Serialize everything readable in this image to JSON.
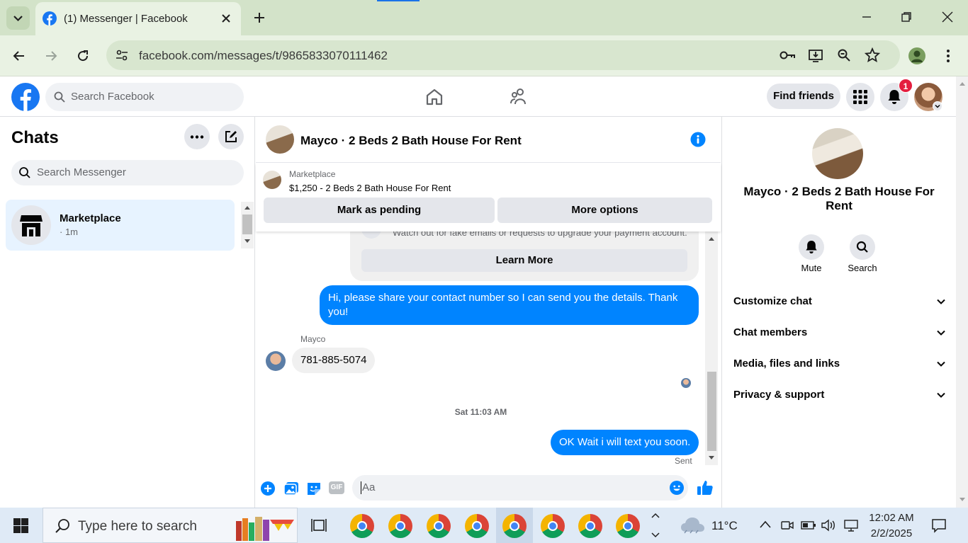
{
  "browser": {
    "tab_title": "(1) Messenger | Facebook",
    "url": "facebook.com/messages/t/9865833070111462"
  },
  "fb_nav": {
    "search_placeholder": "Search Facebook",
    "find_friends": "Find friends",
    "notification_count": "1"
  },
  "sidebar": {
    "title": "Chats",
    "search_placeholder": "Search Messenger",
    "chats": [
      {
        "name": "Marketplace",
        "meta": "· 1m"
      }
    ]
  },
  "conversation": {
    "title": "Mayco · 2 Beds 2 Bath House For Rent",
    "marketplace_label": "Marketplace",
    "listing": "$1,250 - 2 Beds 2 Bath House For Rent",
    "mark_pending": "Mark as pending",
    "more_options": "More options",
    "warning_text": "Watch out for fake emails or requests to upgrade your payment account.",
    "learn_more": "Learn More",
    "messages": [
      {
        "from": "me",
        "text": "Hi, please share your contact number so I can send you the details. Thank you!"
      },
      {
        "from": "Mayco",
        "sender_label": "Mayco",
        "text": "781-885-5074"
      },
      {
        "from": "me",
        "text": "OK Wait i will text you soon."
      }
    ],
    "timestamp": "Sat 11:03 AM",
    "status": "Sent",
    "composer_placeholder": "Aa"
  },
  "details": {
    "title": "Mayco · 2 Beds 2 Bath House For Rent",
    "mute": "Mute",
    "search": "Search",
    "sections": [
      "Customize chat",
      "Chat members",
      "Media, files and links",
      "Privacy & support"
    ]
  },
  "taskbar": {
    "search_placeholder": "Type here to search",
    "weather": "11°C",
    "time": "12:02 AM",
    "date": "2/2/2025"
  },
  "colors": {
    "messenger_blue": "#0084ff",
    "fb_blue": "#1877f2",
    "notification_red": "#e41e3f",
    "chrome_green": "#d3e3c9"
  }
}
